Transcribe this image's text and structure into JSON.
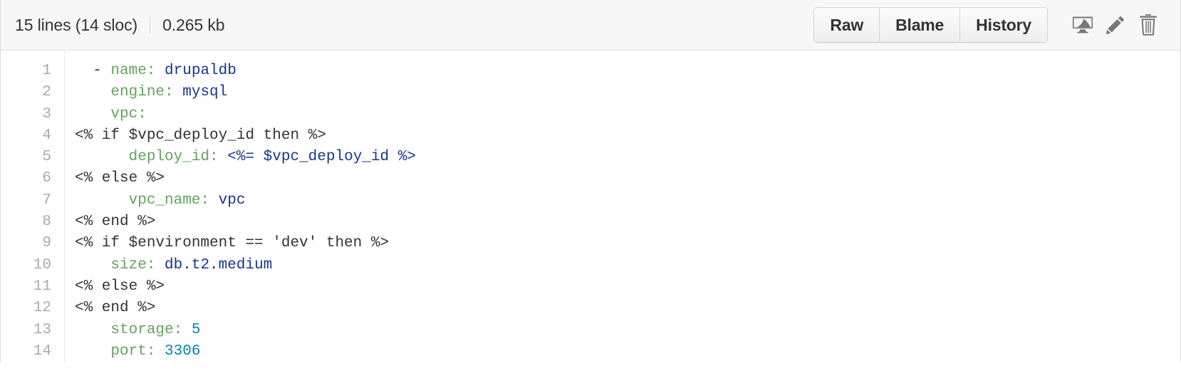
{
  "header": {
    "lines_label": "15 lines (14 sloc)",
    "size_label": "0.265 kb",
    "buttons": [
      {
        "label": "Raw",
        "name": "raw-button"
      },
      {
        "label": "Blame",
        "name": "blame-button"
      },
      {
        "label": "History",
        "name": "history-button"
      }
    ],
    "icons": [
      {
        "name": "desktop-icon",
        "title": "Open this file in GitHub Desktop"
      },
      {
        "name": "pencil-icon",
        "title": "Edit this file"
      },
      {
        "name": "trash-icon",
        "title": "Delete this file"
      }
    ]
  },
  "colors": {
    "key": "#63a35c",
    "string": "#183691",
    "number": "#0086b3",
    "plain": "#333333",
    "line_number": "#aaaaaa",
    "header_bg": "#f7f7f7",
    "border": "#e2e2e2",
    "icon": "#767676"
  },
  "code": {
    "language": "yaml-erb",
    "line_numbers": [
      1,
      2,
      3,
      4,
      5,
      6,
      7,
      8,
      9,
      10,
      11,
      12,
      13,
      14
    ],
    "lines": [
      {
        "num": 1,
        "text": "  - name: drupaldb",
        "tokens": [
          {
            "t": "  - ",
            "c": "plain"
          },
          {
            "t": "name:",
            "c": "key"
          },
          {
            "t": " ",
            "c": "plain"
          },
          {
            "t": "drupaldb",
            "c": "string"
          }
        ]
      },
      {
        "num": 2,
        "text": "    engine: mysql",
        "tokens": [
          {
            "t": "    ",
            "c": "plain"
          },
          {
            "t": "engine:",
            "c": "key"
          },
          {
            "t": " ",
            "c": "plain"
          },
          {
            "t": "mysql",
            "c": "string"
          }
        ]
      },
      {
        "num": 3,
        "text": "    vpc:",
        "tokens": [
          {
            "t": "    ",
            "c": "plain"
          },
          {
            "t": "vpc:",
            "c": "key"
          }
        ]
      },
      {
        "num": 4,
        "text": "<% if $vpc_deploy_id then %>",
        "tokens": [
          {
            "t": "<% if $vpc_deploy_id then %>",
            "c": "plain"
          }
        ]
      },
      {
        "num": 5,
        "text": "      deploy_id: <%= $vpc_deploy_id %>",
        "tokens": [
          {
            "t": "      ",
            "c": "plain"
          },
          {
            "t": "deploy_id:",
            "c": "key"
          },
          {
            "t": " ",
            "c": "plain"
          },
          {
            "t": "<%= $vpc_deploy_id %>",
            "c": "string"
          }
        ]
      },
      {
        "num": 6,
        "text": "<% else %>",
        "tokens": [
          {
            "t": "<% else %>",
            "c": "plain"
          }
        ]
      },
      {
        "num": 7,
        "text": "      vpc_name: vpc",
        "tokens": [
          {
            "t": "      ",
            "c": "plain"
          },
          {
            "t": "vpc_name:",
            "c": "key"
          },
          {
            "t": " ",
            "c": "plain"
          },
          {
            "t": "vpc",
            "c": "string"
          }
        ]
      },
      {
        "num": 8,
        "text": "<% end %>",
        "tokens": [
          {
            "t": "<% end %>",
            "c": "plain"
          }
        ]
      },
      {
        "num": 9,
        "text": "<% if $environment == 'dev' then %>",
        "tokens": [
          {
            "t": "<% if $environment == 'dev' then %>",
            "c": "plain"
          }
        ]
      },
      {
        "num": 10,
        "text": "    size: db.t2.medium",
        "tokens": [
          {
            "t": "    ",
            "c": "plain"
          },
          {
            "t": "size:",
            "c": "key"
          },
          {
            "t": " ",
            "c": "plain"
          },
          {
            "t": "db.t2.medium",
            "c": "string"
          }
        ]
      },
      {
        "num": 11,
        "text": "<% else %>",
        "tokens": [
          {
            "t": "<% else %>",
            "c": "plain"
          }
        ]
      },
      {
        "num": 12,
        "text": "<% end %>",
        "tokens": [
          {
            "t": "<% end %>",
            "c": "plain"
          }
        ]
      },
      {
        "num": 13,
        "text": "    storage: 5",
        "tokens": [
          {
            "t": "    ",
            "c": "plain"
          },
          {
            "t": "storage:",
            "c": "key"
          },
          {
            "t": " ",
            "c": "plain"
          },
          {
            "t": "5",
            "c": "number"
          }
        ]
      },
      {
        "num": 14,
        "text": "    port: 3306",
        "tokens": [
          {
            "t": "    ",
            "c": "plain"
          },
          {
            "t": "port:",
            "c": "key"
          },
          {
            "t": " ",
            "c": "plain"
          },
          {
            "t": "3306",
            "c": "number"
          }
        ]
      }
    ]
  }
}
